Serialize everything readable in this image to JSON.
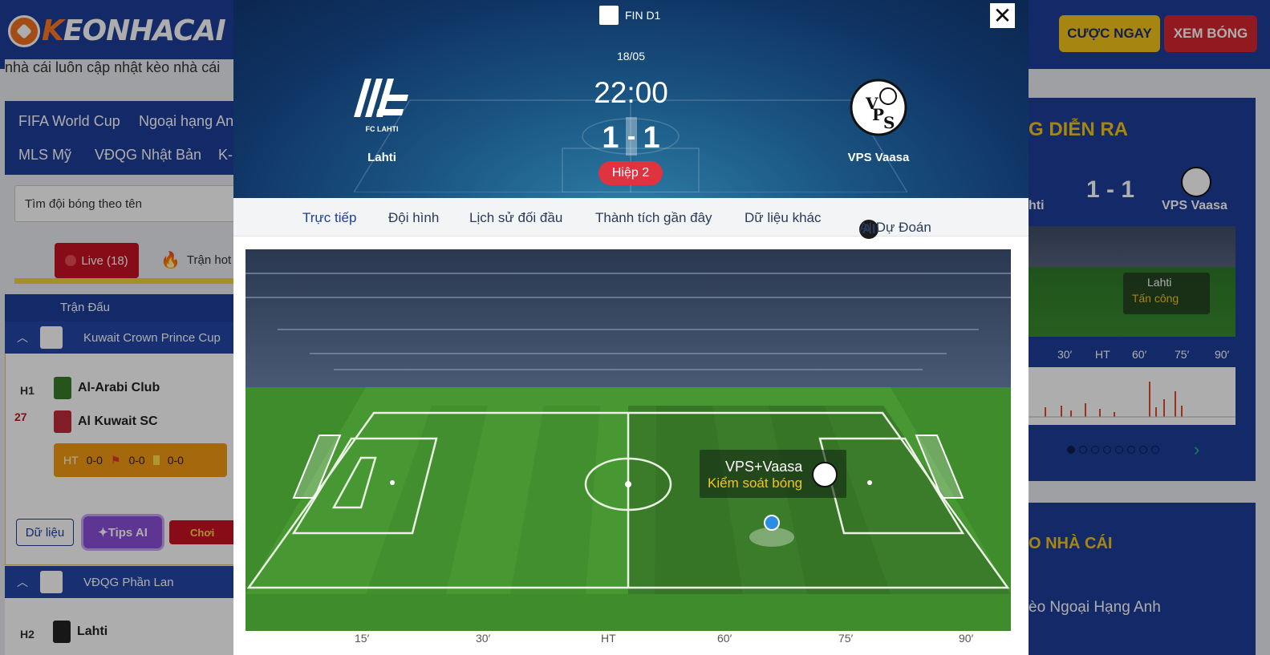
{
  "site": {
    "logo_accent": "K",
    "logo_text": "EONHACAI",
    "cta_bet": "CƯỢC NGAY",
    "cta_watch": "XEM BÓNG",
    "subline": "nhà cái luôn cập nhật kèo nhà cái"
  },
  "left": {
    "league_nav": [
      "FIFA World Cup",
      "Ngoại hạng Anh",
      "MLS Mỹ",
      "VĐQG Nhật Bản",
      "K-L"
    ],
    "search_placeholder": "Tìm đội bóng theo tên",
    "filter_live": "Live (18)",
    "filter_hot": "Trận hot (",
    "col_header": "Trận Đấu",
    "league1": "Kuwait Crown Prince Cup",
    "match1": {
      "period": "H1",
      "minute": "27",
      "home": "Al-Arabi Club",
      "away": "Al Kuwait SC",
      "ht_label": "HT",
      "ht": "0-0",
      "corners": "0-0",
      "cards": "0-0"
    },
    "btn_data": "Dữ liệu",
    "btn_tips": "Tips AI",
    "btn_play": "Chơi",
    "league2": "VĐQG Phần Lan",
    "match2": {
      "period": "H2",
      "home": "Lahti"
    }
  },
  "right": {
    "title": "G DIỄN RA",
    "score": "1 - 1",
    "home": "hti",
    "away": "VPS Vaasa",
    "popup_team": "Lahti",
    "popup_action": "Tấn công",
    "axis": [
      "30′",
      "HT",
      "60′",
      "75′",
      "90′"
    ],
    "odds_title": "O NHÀ CÁI",
    "odds_item": "èo Ngoại Hạng Anh"
  },
  "modal": {
    "league": "FIN D1",
    "date": "18/05",
    "time": "22:00",
    "home_score": "1",
    "away_score": "1",
    "period": "Hiệp 2",
    "home": "Lahti",
    "home_crest_text": "FC LAHTI",
    "away": "VPS Vaasa",
    "away_crest_letters": [
      "V",
      "P",
      "S"
    ],
    "close": "✕",
    "tabs": [
      "Trực tiếp",
      "Đội hình",
      "Lịch sử đối đầu",
      "Thành tích gần đây",
      "Dữ liệu khác",
      "AI Dự Đoán"
    ],
    "ai_badge": "AI",
    "popup_team": "VPS+Vaasa",
    "popup_action": "Kiểm soát bóng",
    "axis": [
      "15′",
      "30′",
      "HT",
      "60′",
      "75′",
      "90′"
    ]
  },
  "colors": {
    "brand": "#1e3f9a",
    "accent_yellow": "#f5c518",
    "live_red": "#c91322",
    "pitch_green": "#3d8a2c"
  }
}
